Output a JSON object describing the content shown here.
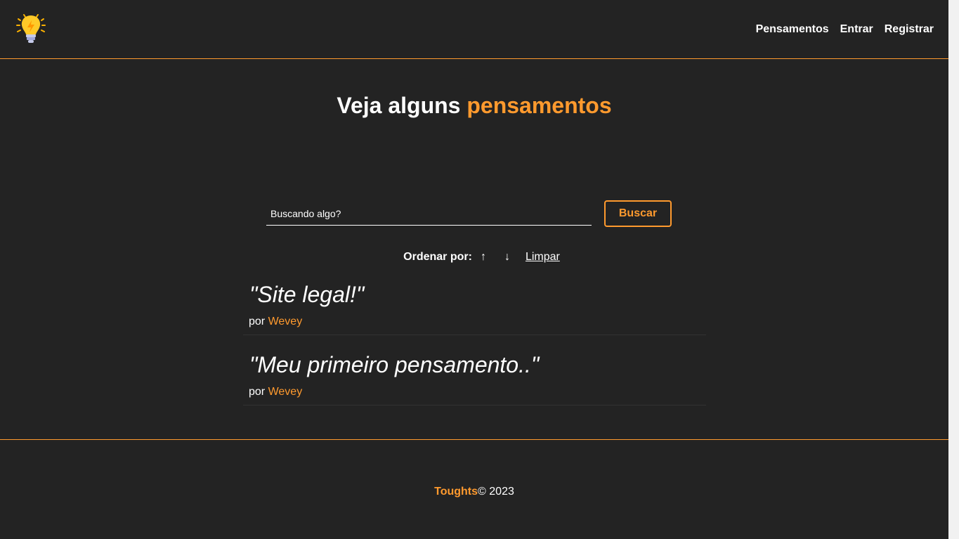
{
  "navbar": {
    "logo_icon": "lightbulb-icon",
    "links": [
      {
        "label": "Pensamentos"
      },
      {
        "label": "Entrar"
      },
      {
        "label": "Registrar"
      }
    ]
  },
  "main": {
    "title_prefix": "Veja alguns",
    "title_accent": "pensamentos",
    "search": {
      "placeholder": "Buscando algo?",
      "value": "",
      "button_label": "Buscar"
    },
    "order": {
      "label": "Ordenar por:",
      "asc_icon": "↑",
      "desc_icon": "↓",
      "clear_label": "Limpar"
    },
    "thoughts": [
      {
        "text": "\"Site legal!\"",
        "by_label": "por",
        "author": "Wevey"
      },
      {
        "text": "\"Meu primeiro pensamento..\"",
        "by_label": "por",
        "author": "Wevey"
      }
    ]
  },
  "footer": {
    "brand": "Toughts",
    "copyright": "© 2023"
  },
  "colors": {
    "background": "#232323",
    "accent": "#ff9a2e",
    "text": "#ffffff"
  }
}
